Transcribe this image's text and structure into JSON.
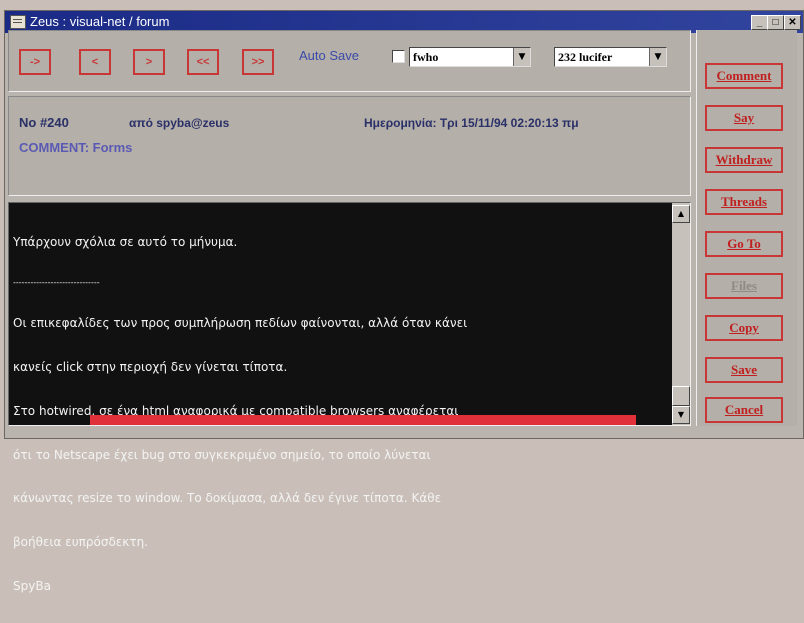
{
  "window": {
    "title": "Zeus : visual-net / forum",
    "controls": [
      "minimize-icon",
      "maximize-icon",
      "close-icon"
    ]
  },
  "nav": {
    "buttons": [
      "->",
      "<",
      ">",
      "<<",
      ">>"
    ],
    "auto_save_label": "Auto Save",
    "auto_save_checked": false,
    "user_select": "fwho",
    "topic_select": "232 lucifer"
  },
  "header": {
    "number": "No #240",
    "from": "από spyba@zeus",
    "date": "Ημερομηνία: Τρι 15/11/94 02:20:13 πμ",
    "comment": "COMMENT: Forms"
  },
  "message": {
    "lines": [
      "Υπάρχουν σχόλια σε αυτό το μήνυμα.",
      "------------------------------",
      "Οι επικεφαλίδες των προς συμπλήρωση πεδίων φαίνονται, αλλά όταν κάνει",
      "κανείς click στην περιοχή δεν γίνεται τίποτα.",
      "Στο hotwired, σε ένα html αναφορικά με compatible browsers αναφέρεται",
      "ότι το Netscape έχει bug στο συγκεκριμένο σημείο, το οποίο λύνεται",
      "κάνωντας resize το window. Το δοκίμασα, αλλά δεν έγινε τίποτα. Κάθε",
      "βοήθεια ευπρόσδεκτη.",
      "SpyBa"
    ]
  },
  "actions": [
    "Comment",
    "Say",
    "Withdraw",
    "Threads",
    "Go To",
    "Files",
    "Copy",
    "Save",
    "Cancel"
  ],
  "colors": {
    "titlebar": "#1a2a86",
    "button_border": "#c83636",
    "message_bg": "#111111"
  }
}
